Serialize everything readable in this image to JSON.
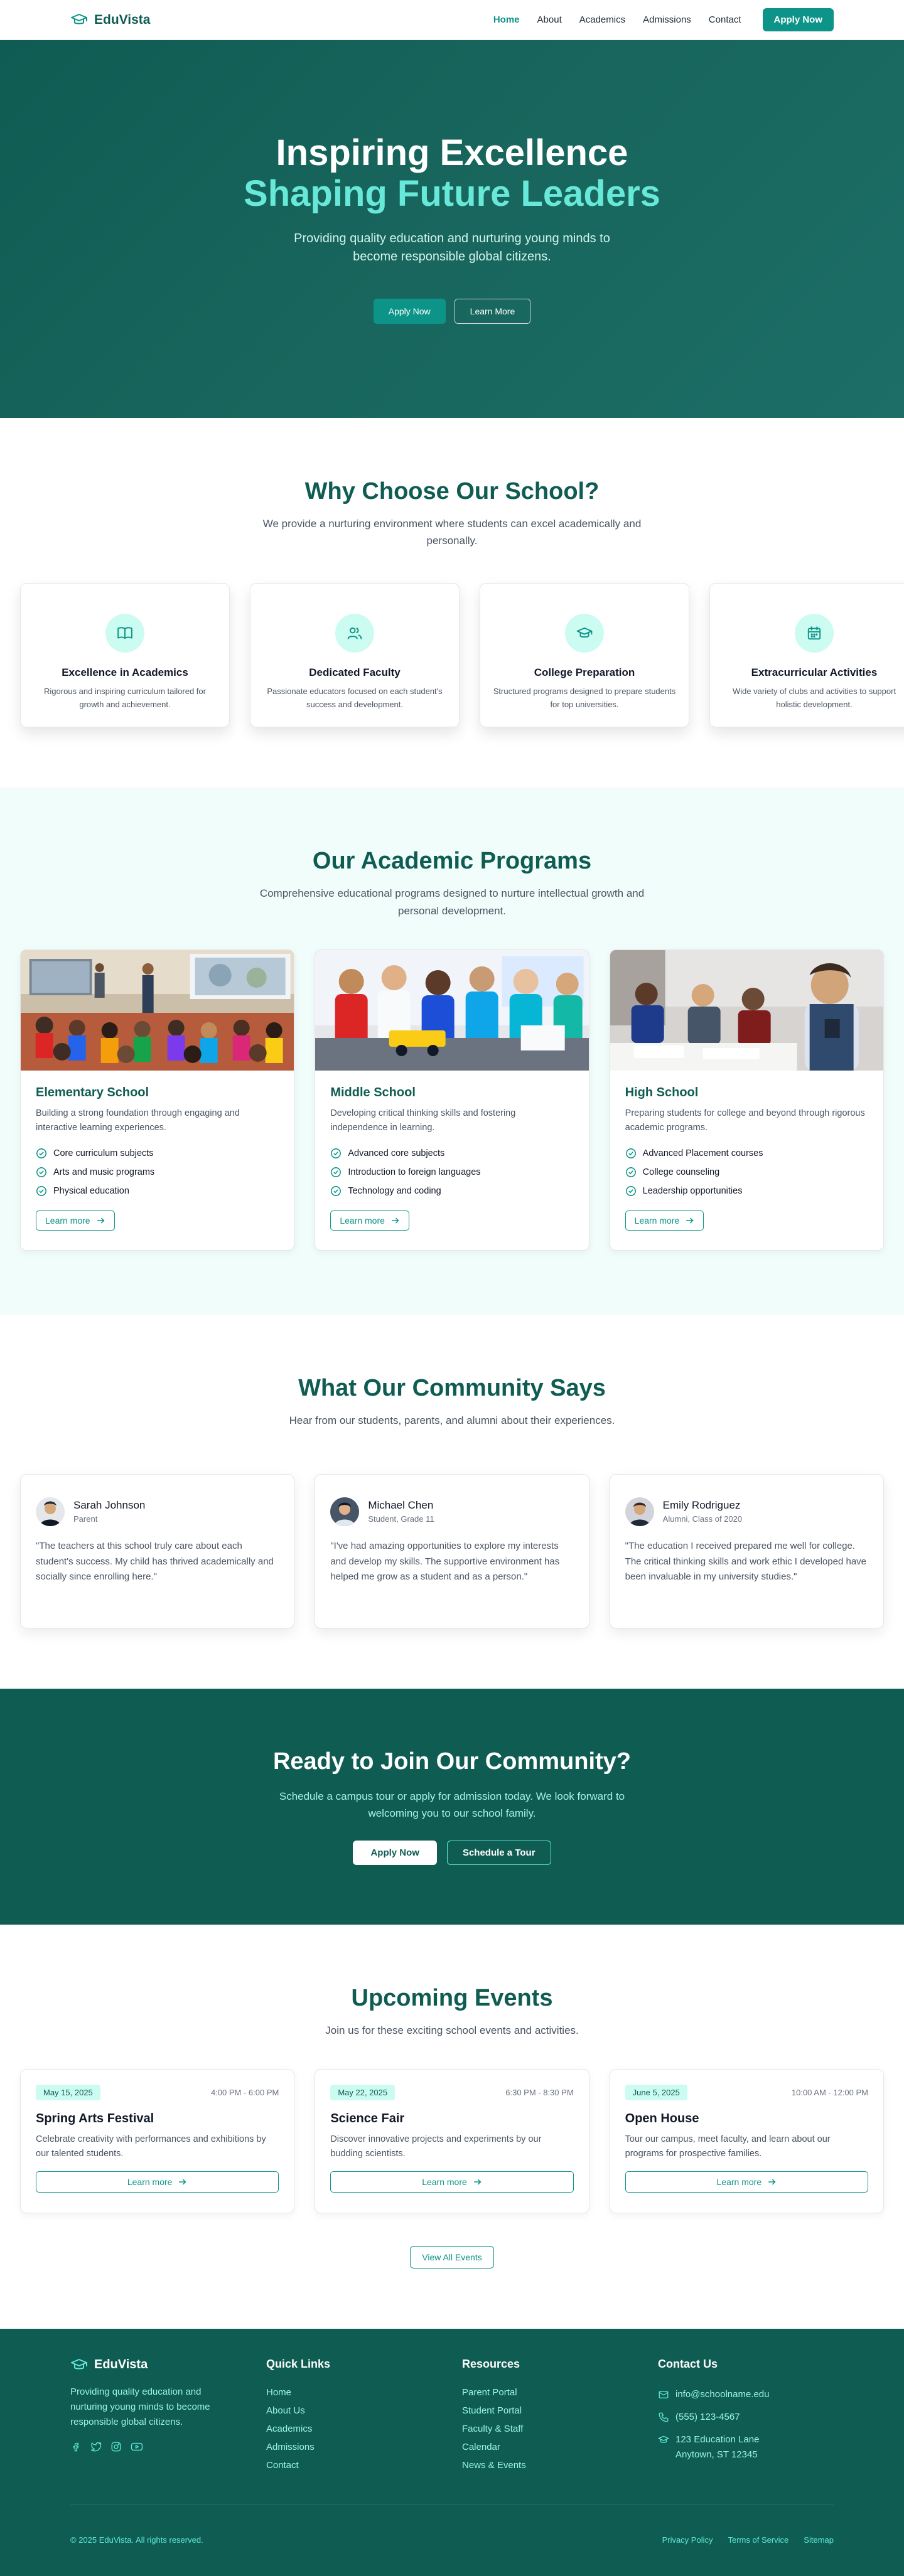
{
  "nav": {
    "brand": "EduVista",
    "links": [
      "Home",
      "About",
      "Academics",
      "Admissions",
      "Contact"
    ],
    "apply_label": "Apply Now"
  },
  "hero": {
    "title": "Inspiring Excellence",
    "subtitle": "Shaping Future Leaders",
    "text": "Providing quality education and nurturing young minds to become responsible global citizens.",
    "primary_label": "Apply Now",
    "secondary_label": "Learn More"
  },
  "why": {
    "title": "Why Choose Our School?",
    "subtitle": "We provide a nurturing environment where students can excel academically and personally.",
    "features": [
      {
        "icon": "book-icon",
        "title": "Excellence in Academics",
        "desc": "Rigorous and inspiring curriculum tailored for growth and achievement."
      },
      {
        "icon": "users-icon",
        "title": "Dedicated Faculty",
        "desc": "Passionate educators focused on each student's success and development."
      },
      {
        "icon": "graduation-cap-icon",
        "title": "College Preparation",
        "desc": "Structured programs designed to prepare students for top universities."
      },
      {
        "icon": "calendar-icon",
        "title": "Extracurricular Activities",
        "desc": "Wide variety of clubs and activities to support holistic development."
      }
    ]
  },
  "programs": {
    "title": "Our Academic Programs",
    "subtitle": "Comprehensive educational programs designed to nurture intellectual growth and personal development.",
    "items": [
      {
        "title": "Elementary School",
        "desc": "Building a strong foundation through engaging and interactive learning experiences.",
        "points": [
          "Core curriculum subjects",
          "Arts and music programs",
          "Physical education"
        ],
        "button": "Learn more"
      },
      {
        "title": "Middle School",
        "desc": "Developing critical thinking skills and fostering independence in learning.",
        "points": [
          "Advanced core subjects",
          "Introduction to foreign languages",
          "Technology and coding"
        ],
        "button": "Learn more"
      },
      {
        "title": "High School",
        "desc": "Preparing students for college and beyond through rigorous academic programs.",
        "points": [
          "Advanced Placement courses",
          "College counseling",
          "Leadership opportunities"
        ],
        "button": "Learn more"
      }
    ]
  },
  "testimonials": {
    "title": "What Our Community Says",
    "subtitle": "Hear from our students, parents, and alumni about their experiences.",
    "items": [
      {
        "name": "Sarah Johnson",
        "role": "Parent",
        "quote": "\"The teachers at this school truly care about each student's success. My child has thrived academically and socially since enrolling here.\""
      },
      {
        "name": "Michael Chen",
        "role": "Student, Grade 11",
        "quote": "\"I've had amazing opportunities to explore my interests and develop my skills. The supportive environment has helped me grow as a student and as a person.\""
      },
      {
        "name": "Emily Rodriguez",
        "role": "Alumni, Class of 2020",
        "quote": "\"The education I received prepared me well for college. The critical thinking skills and work ethic I developed have been invaluable in my university studies.\""
      }
    ]
  },
  "cta": {
    "title": "Ready to Join Our Community?",
    "text": "Schedule a campus tour or apply for admission today. We look forward to welcoming you to our school family.",
    "primary_label": "Apply Now",
    "secondary_label": "Schedule a Tour"
  },
  "events": {
    "title": "Upcoming Events",
    "subtitle": "Join us for these exciting school events and activities.",
    "items": [
      {
        "date": "May 15, 2025",
        "time": "4:00 PM - 6:00 PM",
        "title": "Spring Arts Festival",
        "desc": "Celebrate creativity with performances and exhibitions by our talented students.",
        "button": "Learn more"
      },
      {
        "date": "May 22, 2025",
        "time": "6:30 PM - 8:30 PM",
        "title": "Science Fair",
        "desc": "Discover innovative projects and experiments by our budding scientists.",
        "button": "Learn more"
      },
      {
        "date": "June 5, 2025",
        "time": "10:00 AM - 12:00 PM",
        "title": "Open House",
        "desc": "Tour our campus, meet faculty, and learn about our programs for prospective families.",
        "button": "Learn more"
      }
    ],
    "view_all": "View All Events"
  },
  "footer": {
    "brand": "EduVista",
    "about": "Providing quality education and nurturing young minds to become responsible global citizens.",
    "socials": [
      "facebook-icon",
      "twitter-icon",
      "instagram-icon",
      "youtube-icon"
    ],
    "quick_links_title": "Quick Links",
    "quick_links": [
      "Home",
      "About Us",
      "Academics",
      "Admissions",
      "Contact"
    ],
    "resources_title": "Resources",
    "resources": [
      "Parent Portal",
      "Student Portal",
      "Faculty & Staff",
      "Calendar",
      "News & Events"
    ],
    "contact_title": "Contact Us",
    "email": "info@schoolname.edu",
    "phone": "(555) 123-4567",
    "address_line1": "123 Education Lane",
    "address_line2": "Anytown, ST 12345",
    "copyright": "© 2025 EduVista. All rights reserved.",
    "legal": [
      "Privacy Policy",
      "Terms of Service",
      "Sitemap"
    ]
  },
  "colors": {
    "brand_dark": "#0f5c53",
    "accent": "#0d9488",
    "accent_light": "#67e8d9",
    "tint": "#f0fdfa"
  }
}
